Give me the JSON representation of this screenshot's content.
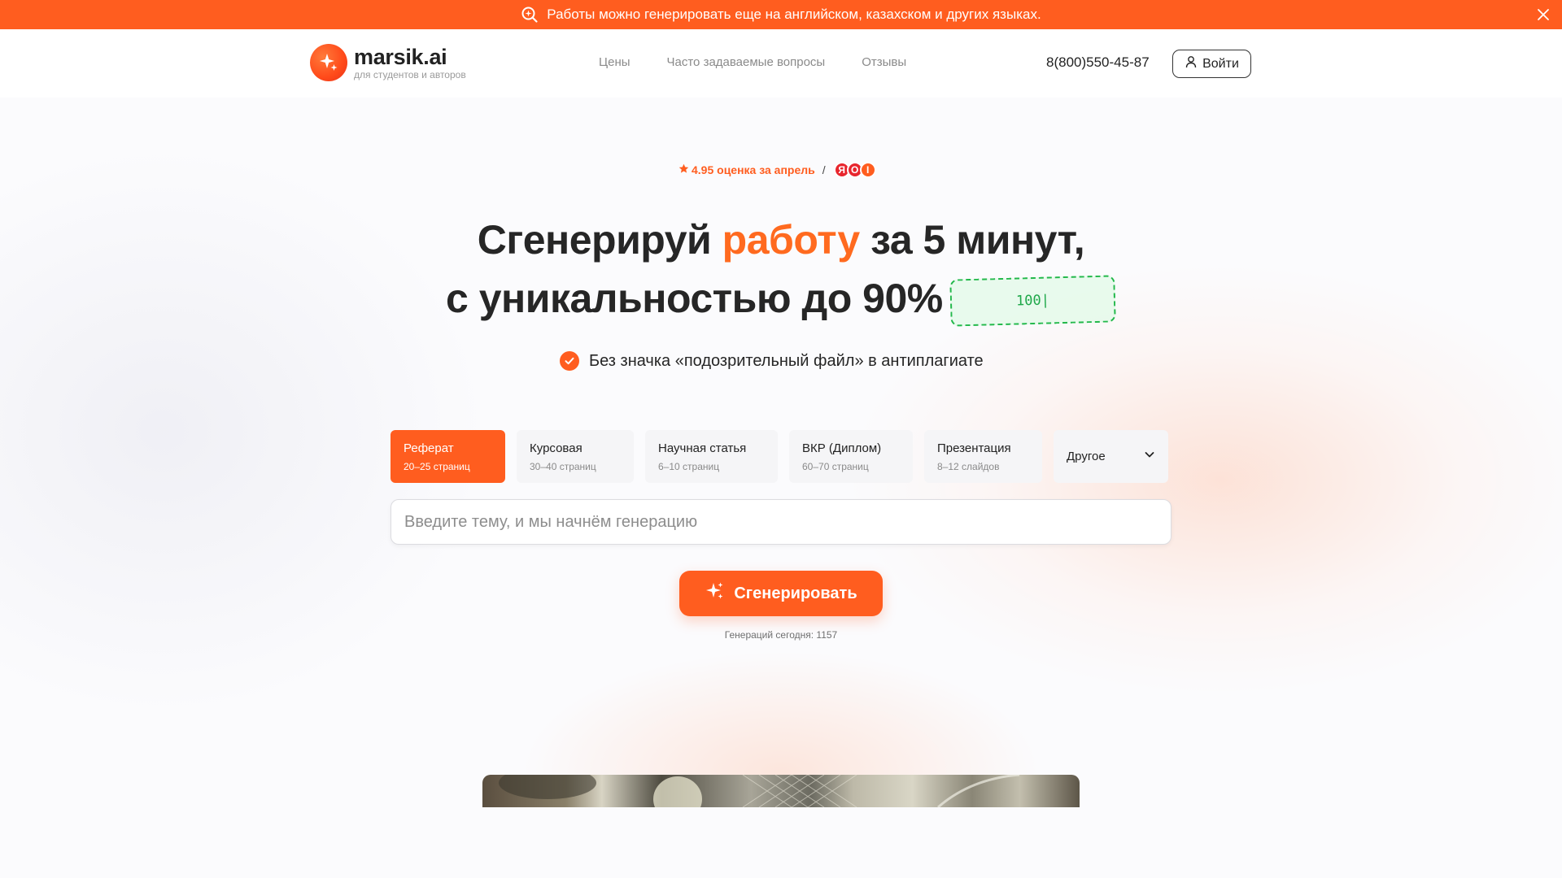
{
  "announcement": {
    "text": "Работы можно генерировать еще на английском, казахском и других языках.",
    "icon": "search-sparkle-icon",
    "close_icon": "close-icon"
  },
  "header": {
    "logo_name": "marsik.ai",
    "logo_subtitle": "для студентов и авторов",
    "nav": [
      "Цены",
      "Часто задаваемые вопросы",
      "Отзывы"
    ],
    "phone": "8(800)550-45-87",
    "login_label": "Войти"
  },
  "hero": {
    "rating_text": "4.95 оценка за апрель",
    "rating_separator": "/",
    "review_badges": [
      {
        "letter": "Я",
        "color": "#e8262e"
      },
      {
        "letter": "O",
        "color": "#e8262e"
      },
      {
        "letter": "I",
        "color": "#ff5d1f"
      }
    ],
    "title_part1": "Сгенерируй",
    "title_accent": "работу",
    "title_part2": "за 5 минут,",
    "title_line2": "с уникальностью до 90%",
    "uniq_box_text": "100|",
    "check_text": "Без значка «подозрительный файл» в антиплагиате"
  },
  "work_types": [
    {
      "title": "Реферат",
      "subtitle": "20–25 страниц",
      "active": true
    },
    {
      "title": "Курсовая",
      "subtitle": "30–40 страниц",
      "active": false
    },
    {
      "title": "Научная статья",
      "subtitle": "6–10 страниц",
      "active": false
    },
    {
      "title": "ВКР (Диплом)",
      "subtitle": "60–70 страниц",
      "active": false
    },
    {
      "title": "Презентация",
      "subtitle": "8–12 слайдов",
      "active": false
    }
  ],
  "other_dropdown": {
    "label": "Другое",
    "icon": "chevron-down-icon"
  },
  "topic_input": {
    "value": "",
    "placeholder": "Введите тему, и мы начнём генерацию"
  },
  "generate_button": {
    "label": "Сгенерировать",
    "icon": "sparkle-icon"
  },
  "generations_today": "Генераций сегодня: 1157",
  "colors": {
    "accent": "#ff5d1f",
    "text": "#262626",
    "success": "#22b84a"
  }
}
